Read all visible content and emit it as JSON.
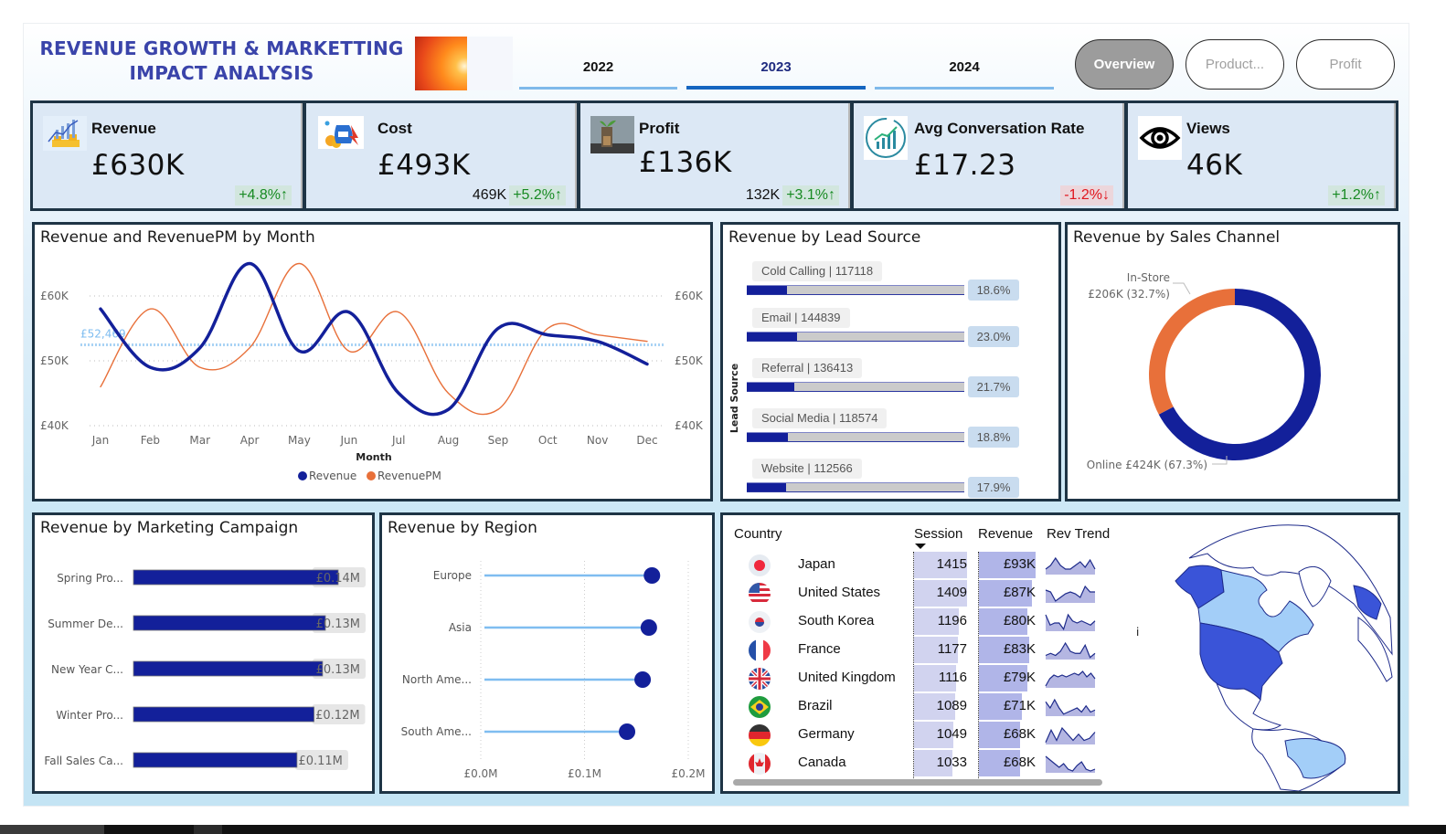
{
  "header": {
    "title_line1": "REVENUE GROWTH & MARKETTING",
    "title_line2": "IMPACT ANALYSIS",
    "year_tabs": [
      {
        "label": "2022",
        "active": false
      },
      {
        "label": "2023",
        "active": true
      },
      {
        "label": "2024",
        "active": false
      }
    ],
    "nav_buttons": [
      {
        "label": "Overview",
        "active": true
      },
      {
        "label": "Product...",
        "active": false
      },
      {
        "label": "Profit",
        "active": false
      }
    ]
  },
  "kpis": [
    {
      "name": "Revenue",
      "icon": "revenue-chart-icon",
      "value": "£630K",
      "previous": "",
      "change": "+4.8%↑",
      "direction": "up"
    },
    {
      "name": "Cost",
      "icon": "cost-bag-icon",
      "value": "£493K",
      "previous": "469K",
      "change": "+5.2%↑",
      "direction": "up"
    },
    {
      "name": "Profit",
      "icon": "profit-plant-icon",
      "value": "£136K",
      "previous": "132K",
      "change": "+3.1%↑",
      "direction": "up"
    },
    {
      "name": "Avg Conversation Rate",
      "icon": "conversion-growth-icon",
      "value": "£17.23",
      "previous": "",
      "change": "-1.2%↓",
      "direction": "down"
    },
    {
      "name": "Views",
      "icon": "eye-icon",
      "value": "46K",
      "previous": "",
      "change": "+1.2%↑",
      "direction": "up"
    }
  ],
  "colors": {
    "primary": "#13209a",
    "accent_orange": "#e8703a",
    "light_blue": "#7fbdf0",
    "up": "#178a22",
    "down": "#e0151d"
  },
  "chart_data": [
    {
      "id": "revenue-by-month",
      "type": "line",
      "title": "Revenue and RevenuePM by Month",
      "xlabel": "Month",
      "ylabel": "",
      "categories": [
        "Jan",
        "Feb",
        "Mar",
        "Apr",
        "May",
        "Jun",
        "Jul",
        "Aug",
        "Sep",
        "Oct",
        "Nov",
        "Dec"
      ],
      "series": [
        {
          "name": "Revenue",
          "values": [
            58000,
            49000,
            52000,
            65000,
            51500,
            57500,
            45000,
            42500,
            55000,
            54000,
            53000,
            49500
          ]
        },
        {
          "name": "RevenuePM",
          "values": [
            46000,
            58000,
            49000,
            52000,
            65000,
            51500,
            57500,
            45000,
            42500,
            55000,
            54000,
            53000
          ]
        }
      ],
      "average_line": {
        "value": 52469,
        "label": "£52,469"
      },
      "ylim": [
        40000,
        65000
      ],
      "y_ticks": [
        "£40K",
        "£50K",
        "£60K"
      ],
      "y_tick_values": [
        40000,
        50000,
        60000
      ],
      "grid": true,
      "legend": "bottom-center"
    },
    {
      "id": "revenue-by-lead-source",
      "type": "bar",
      "title": "Revenue by Lead Source",
      "ylabel": "Lead Source",
      "categories": [
        "Cold Calling",
        "Email",
        "Referral",
        "Social Media",
        "Website"
      ],
      "values": [
        117118,
        144839,
        136413,
        118574,
        112566
      ],
      "percent_labels": [
        "18.6%",
        "23.0%",
        "21.7%",
        "18.8%",
        "17.9%"
      ],
      "labels": [
        "Cold Calling | 117118",
        "Email | 144839",
        "Referral | 136413",
        "Social Media | 118574",
        "Website | 112566"
      ],
      "xlim": [
        0,
        630000
      ]
    },
    {
      "id": "revenue-by-sales-channel",
      "type": "pie",
      "title": "Revenue by Sales Channel",
      "categories": [
        "Online",
        "In-Store"
      ],
      "values": [
        424000,
        206000
      ],
      "percents": [
        67.3,
        32.7
      ],
      "labels": [
        "Online £424K (67.3%)",
        "In-Store £206K (32.7%)"
      ],
      "label_in_store_line1": "In-Store",
      "label_in_store_line2": "£206K (32.7%)",
      "donut": true
    },
    {
      "id": "revenue-by-marketing-campaign",
      "type": "bar",
      "title": "Revenue by Marketing Campaign",
      "categories": [
        "Spring Pro...",
        "Summer De...",
        "New Year C...",
        "Winter Pro...",
        "Fall Sales Ca..."
      ],
      "values": [
        0.14,
        0.13,
        0.13,
        0.12,
        0.11
      ],
      "raw_bar_fraction": [
        0.144,
        0.135,
        0.133,
        0.127,
        0.115
      ],
      "value_labels": [
        "£0.14M",
        "£0.13M",
        "£0.13M",
        "£0.12M",
        "£0.11M"
      ],
      "xlim": [
        0,
        0.15
      ],
      "unit": "£M"
    },
    {
      "id": "revenue-by-region",
      "type": "scatter",
      "title": "Revenue by Region",
      "categories": [
        "Europe",
        "Asia",
        "North Ame...",
        "South Ame..."
      ],
      "values": [
        0.165,
        0.162,
        0.156,
        0.141
      ],
      "xlim": [
        0,
        0.2
      ],
      "x_ticks": [
        "£0.0M",
        "£0.1M",
        "£0.2M"
      ],
      "x_tick_values": [
        0,
        0.1,
        0.2
      ],
      "unit": "£M",
      "grid": true
    },
    {
      "id": "country-table",
      "type": "table",
      "columns": [
        "Country",
        "Session",
        "Revenue",
        "Rev Trend"
      ],
      "sort_column": "Session",
      "sort_direction": "descending",
      "rows": [
        {
          "country": "Japan",
          "flag": "japan-flag-icon",
          "session": 1415,
          "session_label": "1415",
          "revenue": 93,
          "revenue_label": "£93K",
          "trend": [
            3,
            5,
            9,
            5,
            3,
            3,
            5,
            7,
            4,
            8,
            3
          ]
        },
        {
          "country": "United States",
          "flag": "usa-flag-icon",
          "session": 1409,
          "session_label": "1409",
          "revenue": 87,
          "revenue_label": "£87K",
          "trend": [
            7,
            6,
            1,
            3,
            5,
            6,
            5,
            3,
            9,
            6,
            6
          ]
        },
        {
          "country": "South Korea",
          "flag": "south-korea-flag-icon",
          "session": 1196,
          "session_label": "1196",
          "revenue": 80,
          "revenue_label": "£80K",
          "trend": [
            8,
            3,
            4,
            4,
            1,
            8,
            5,
            4,
            5,
            4,
            3,
            5
          ]
        },
        {
          "country": "France",
          "flag": "france-flag-icon",
          "session": 1177,
          "session_label": "1177",
          "revenue": 83,
          "revenue_label": "£83K",
          "trend": [
            2,
            3,
            2,
            4,
            8,
            4,
            3,
            3,
            7,
            1,
            3
          ]
        },
        {
          "country": "United Kingdom",
          "flag": "uk-flag-icon",
          "session": 1116,
          "session_label": "1116",
          "revenue": 79,
          "revenue_label": "£79K",
          "trend": [
            1,
            5,
            7,
            6,
            7,
            6,
            7,
            8,
            7,
            9,
            6,
            8,
            5
          ]
        },
        {
          "country": "Brazil",
          "flag": "brazil-flag-icon",
          "session": 1089,
          "session_label": "1089",
          "revenue": 71,
          "revenue_label": "£71K",
          "trend": [
            7,
            4,
            8,
            4,
            1,
            2,
            3,
            4,
            2,
            5,
            2,
            3
          ]
        },
        {
          "country": "Germany",
          "flag": "germany-flag-icon",
          "session": 1049,
          "session_label": "1049",
          "revenue": 68,
          "revenue_label": "£68K",
          "trend": [
            1,
            7,
            2,
            8,
            5,
            2,
            5,
            2,
            3,
            6
          ]
        },
        {
          "country": "Canada",
          "flag": "canada-flag-icon",
          "session": 1033,
          "session_label": "1033",
          "revenue": 68,
          "revenue_label": "£68K",
          "trend": [
            9,
            7,
            5,
            3,
            5,
            2,
            1,
            4,
            6,
            2,
            1,
            2
          ]
        }
      ]
    }
  ],
  "map": {
    "name": "country-revenue-map",
    "highlight_dark": "#3a54d8",
    "highlight_light": "#a3cef8"
  }
}
